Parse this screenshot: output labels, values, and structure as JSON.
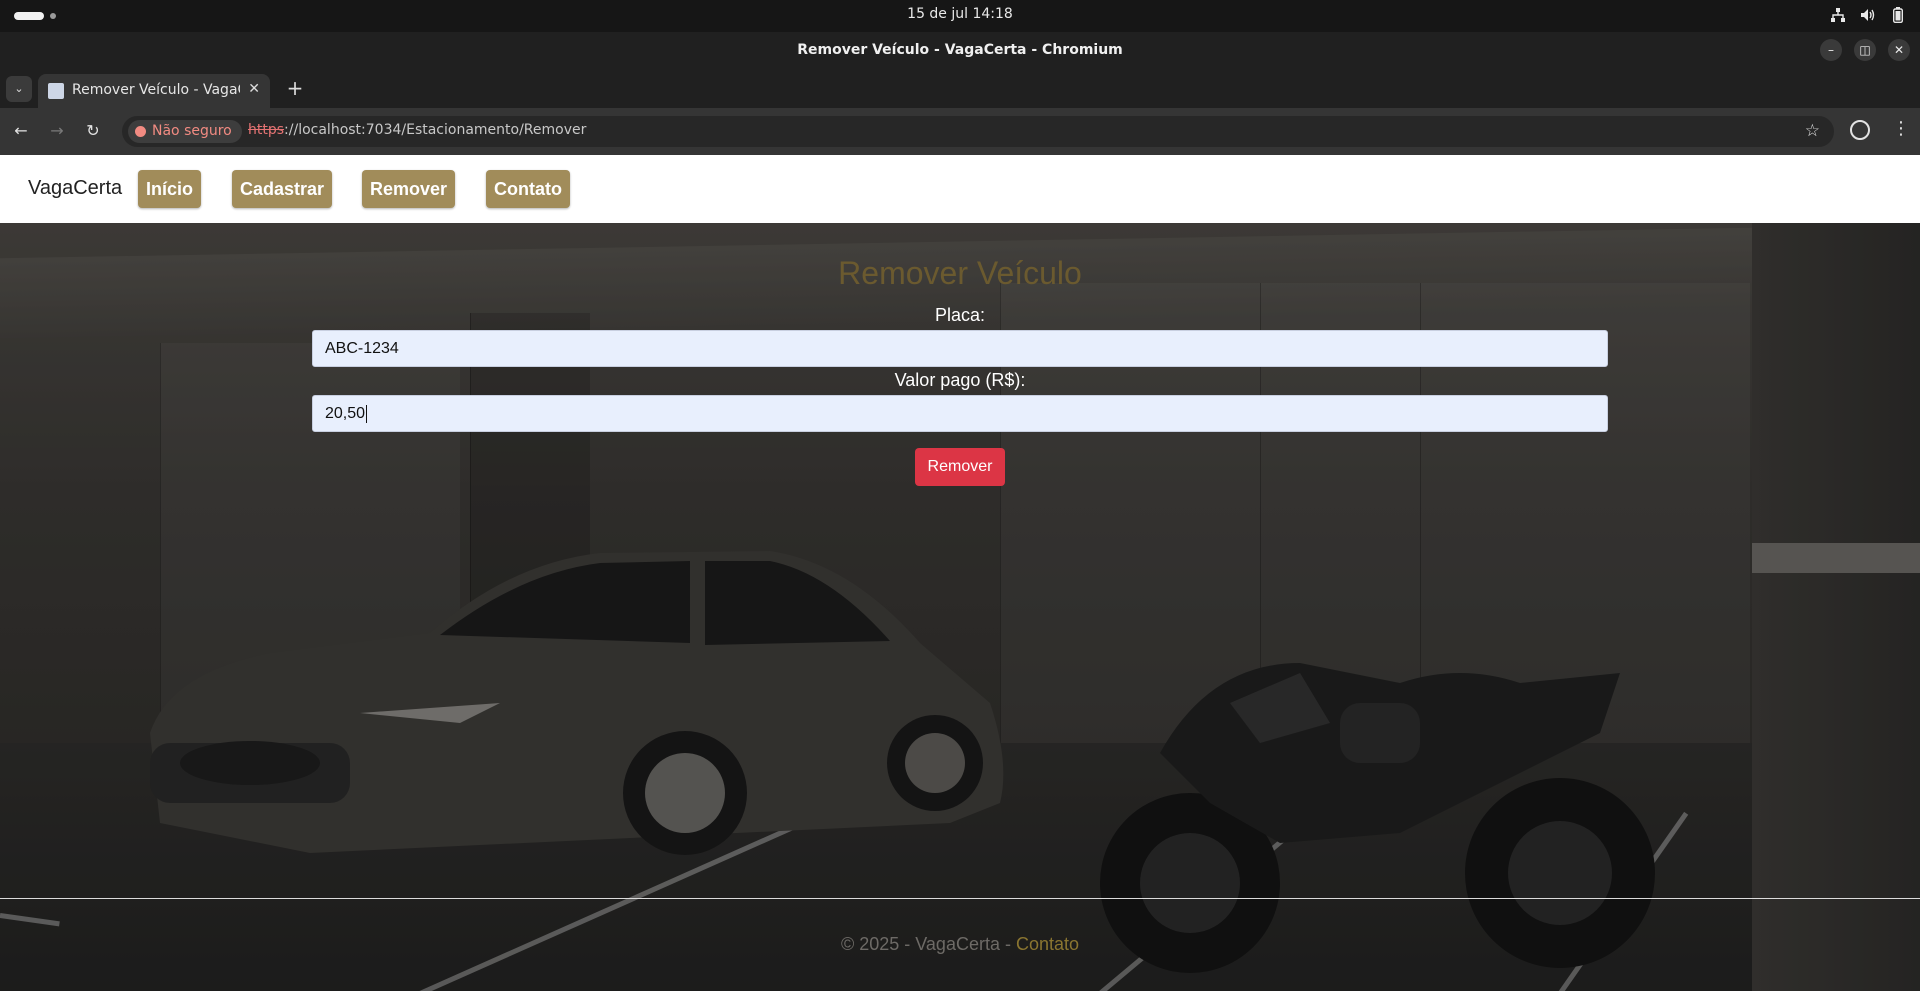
{
  "os": {
    "datetime": "15 de jul  14:18",
    "tray_icons": [
      "network-icon",
      "volume-icon",
      "battery-icon"
    ]
  },
  "window": {
    "title": "Remover Veículo - VagaCerta - Chromium",
    "controls": [
      "minimize-icon",
      "restore-icon",
      "close-icon"
    ]
  },
  "browser": {
    "tab_title": "Remover Veículo - VagaC",
    "security_label": "Não seguro",
    "url_scheme": "https",
    "url_rest": "://localhost:7034/Estacionamento/Remover"
  },
  "site": {
    "brand": "VagaCerta",
    "nav": [
      "Início",
      "Cadastrar",
      "Remover",
      "Contato"
    ],
    "accent_color": "#a18c5a"
  },
  "form": {
    "title": "Remover Veículo",
    "placa_label": "Placa:",
    "placa_value": "ABC-1234",
    "valor_label": "Valor pago (R$):",
    "valor_value": "20,50",
    "submit_label": "Remover",
    "submit_color": "#dc3545"
  },
  "footer": {
    "text": "© 2025 - VagaCerta - ",
    "link": "Contato"
  }
}
